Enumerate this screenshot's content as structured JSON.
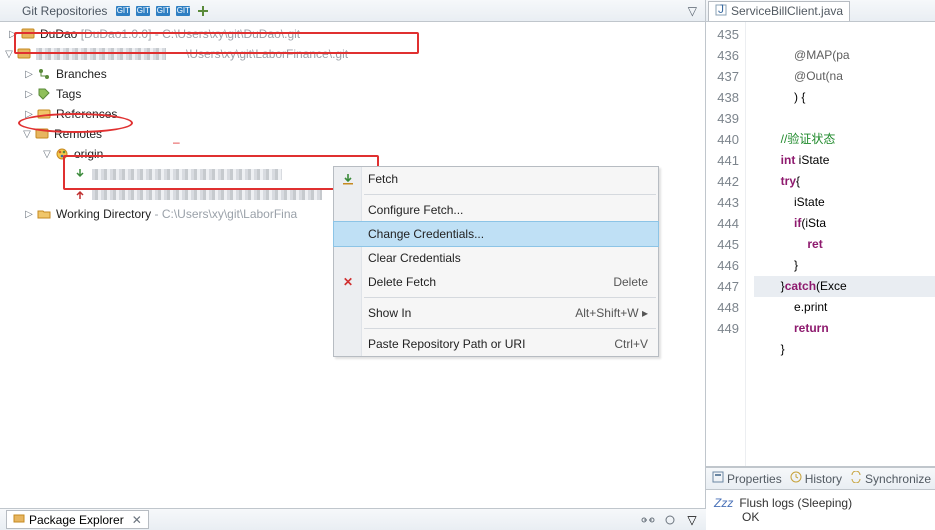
{
  "header": {
    "title": "Git Repositories"
  },
  "tree": {
    "dudao": {
      "name": "DuDao",
      "branch": "[DuDao1.0.0]",
      "path": "- C:\\Users\\xy\\git\\DuDao\\.git"
    },
    "labor": {
      "path_tail": "\\Users\\xy\\git\\LaborFinance\\.git"
    },
    "branches": "Branches",
    "tags": "Tags",
    "references": "References",
    "remotes": "Remotes",
    "origin": "origin",
    "origin_ext": "git",
    "workdir": {
      "label": "Working Directory",
      "path": "- C:\\Users\\xy\\git\\LaborFina"
    }
  },
  "ctx": {
    "fetch": "Fetch",
    "configure_fetch": "Configure Fetch...",
    "change_creds": "Change Credentials...",
    "clear_creds": "Clear Credentials",
    "delete_fetch": "Delete Fetch",
    "delete_accel": "Delete",
    "show_in": "Show In",
    "show_in_accel": "Alt+Shift+W ",
    "paste": "Paste Repository Path or URI",
    "paste_accel": "Ctrl+V"
  },
  "editor": {
    "tab": "ServiceBillClient.java",
    "lines": [
      "435",
      "436",
      "437",
      "438",
      "439",
      "440",
      "441",
      "442",
      "443",
      "444",
      "445",
      "446",
      "447",
      "448",
      "449"
    ],
    "code": {
      "l435": "@MAP(pa",
      "l436": "@Out(na",
      "l437": ") {",
      "l438": "",
      "l439": "//验证状态",
      "l440_a": "int",
      "l440_b": " iState ",
      "l441_a": "try",
      "l441_b": "{",
      "l442": "iState",
      "l443_a": "if",
      "l443_b": "(iSta",
      "l444_a": "ret",
      "l445": "}",
      "l446_a": "}",
      "l446_b": "catch",
      "l446_c": "(Exce",
      "l447": "e.print",
      "l448_a": "return",
      "l449": "}"
    }
  },
  "props": {
    "tab1": "Properties",
    "tab2": "History",
    "tab3": "Synchronize",
    "line1": "Flush logs (Sleeping)",
    "line2": "OK"
  },
  "pkg": {
    "label": "Package Explorer"
  }
}
